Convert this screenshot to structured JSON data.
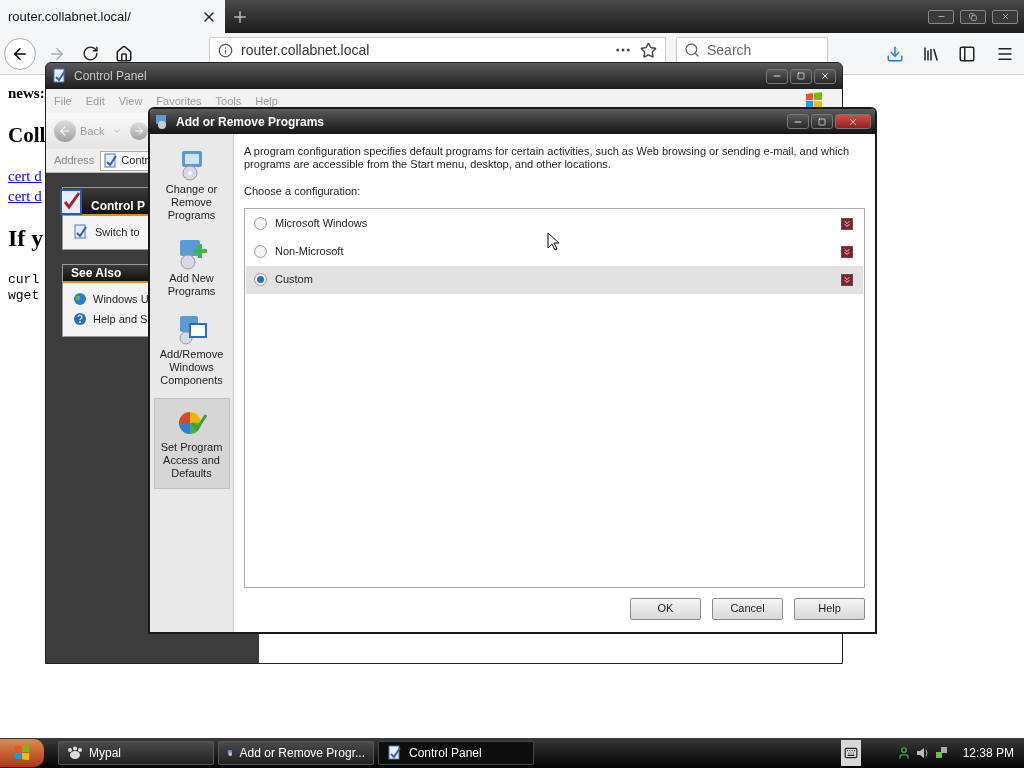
{
  "browser": {
    "tab_title": "router.collabnet.local/",
    "url": "router.collabnet.local",
    "search": {
      "placeholder": "Search"
    }
  },
  "page": {
    "lines": [
      {
        "kind": "bold",
        "text": "news:"
      },
      {
        "kind": "heading",
        "text": "Coll"
      },
      {
        "kind": "link",
        "text": "cert d"
      },
      {
        "kind": "link",
        "text": "cert d"
      },
      {
        "kind": "heading_large",
        "text": "If y"
      },
      {
        "kind": "code",
        "text": "curl"
      },
      {
        "kind": "code",
        "text": "wget"
      }
    ]
  },
  "control_panel": {
    "title": "Control Panel",
    "menu": [
      "File",
      "Edit",
      "View",
      "Favorites",
      "Tools",
      "Help"
    ],
    "back_label": "Back",
    "address_label": "Address",
    "address_value": "Contr",
    "task_panes": [
      {
        "title": "Control P",
        "kind": "main",
        "items": [
          "Switch to"
        ]
      },
      {
        "title": "See Also",
        "kind": "plain",
        "items": [
          "Windows U",
          "Help and S"
        ]
      }
    ]
  },
  "dialog": {
    "title": "Add or Remove Programs",
    "sidebar": [
      {
        "label": "Change or Remove Programs",
        "kind": "change",
        "selected": false
      },
      {
        "label": "Add New Programs",
        "kind": "add",
        "selected": false
      },
      {
        "label": "Add/Remove Windows Components",
        "kind": "components",
        "selected": false
      },
      {
        "label": "Set Program Access and Defaults",
        "kind": "defaults",
        "selected": true
      }
    ],
    "description": "A program configuration specifies default programs for certain activities, such as Web browsing or sending e-mail, and which programs are accessible from the Start menu, desktop, and other locations.",
    "choose_label": "Choose a configuration:",
    "configurations": [
      {
        "label": "Microsoft Windows",
        "selected": false
      },
      {
        "label": "Non-Microsoft",
        "selected": false
      },
      {
        "label": "Custom",
        "selected": true
      }
    ],
    "buttons": [
      "OK",
      "Cancel",
      "Help"
    ]
  },
  "taskbar": {
    "tasks": [
      {
        "label": "Mypal",
        "kind": "browser",
        "selected": false
      },
      {
        "label": "Add or Remove Progr...",
        "kind": "programs",
        "selected": false
      },
      {
        "label": "Control Panel",
        "kind": "panel",
        "selected": true
      }
    ],
    "clock": "12:38 PM"
  }
}
